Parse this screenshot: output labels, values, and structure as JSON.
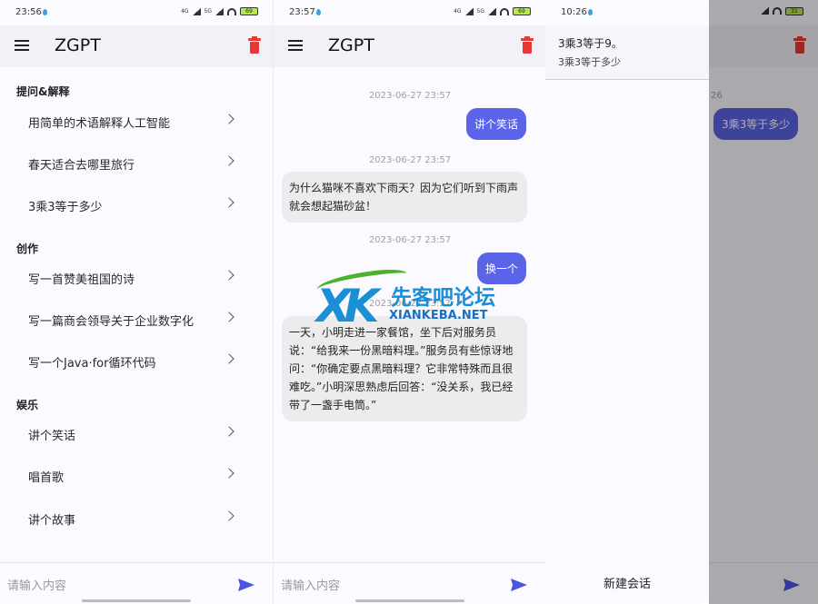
{
  "colors": {
    "accent": "#5b64e8",
    "trash": "#e53935",
    "appbar": "#f3f1f8",
    "bot_bubble": "#ececee"
  },
  "screen1": {
    "status": {
      "time": "23:56",
      "battery": "69",
      "net1": "4G",
      "net2": "5G"
    },
    "app_title": "ZGPT",
    "sections": [
      {
        "title": "提问&解释",
        "items": [
          "用简单的术语解释人工智能",
          "春天适合去哪里旅行",
          "3乘3等于多少"
        ]
      },
      {
        "title": "创作",
        "items": [
          "写一首赞美祖国的诗",
          "写一篇商会领导关于企业数字化",
          "写一个Java·for循环代码"
        ]
      },
      {
        "title": "娱乐",
        "items": [
          "讲个笑话",
          "唱首歌",
          "讲个故事"
        ]
      }
    ],
    "input_placeholder": "请输入内容"
  },
  "screen2": {
    "status": {
      "time": "23:57",
      "battery": "69",
      "net1": "4G",
      "net2": "5G"
    },
    "app_title": "ZGPT",
    "messages": [
      {
        "time": "2023-06-27 23:57",
        "role": "user",
        "text": "讲个笑话"
      },
      {
        "time": "2023-06-27 23:57",
        "role": "bot",
        "text": "为什么猫咪不喜欢下雨天？因为它们听到下雨声就会想起猫砂盆！"
      },
      {
        "time": "2023-06-27 23:57",
        "role": "user",
        "text": "换一个"
      },
      {
        "time": "2023-06-27 23:57",
        "role": "bot",
        "text": "一天，小明走进一家餐馆，坐下后对服务员说：“给我来一份黑暗料理。”服务员有些惊讶地问：“你确定要点黑暗料理？它非常特殊而且很难吃。”小明深思熟虑后回答：“没关系，我已经带了一盏手电筒。”"
      }
    ],
    "input_placeholder": "请输入内容"
  },
  "screen3": {
    "status": {
      "time": "10:26",
      "battery": "31"
    },
    "drawer": {
      "items": [
        {
          "title": "3乘3等于9。",
          "subtitle": "3乘3等于多少"
        }
      ],
      "new_chat_label": "新建会话"
    },
    "behind": {
      "timestamp_fragment": "26",
      "bubble": "3乘3等于多少"
    }
  },
  "watermark": {
    "logo": "XK",
    "cn": "先客吧论坛",
    "en": "XIANKEBA.NET"
  }
}
